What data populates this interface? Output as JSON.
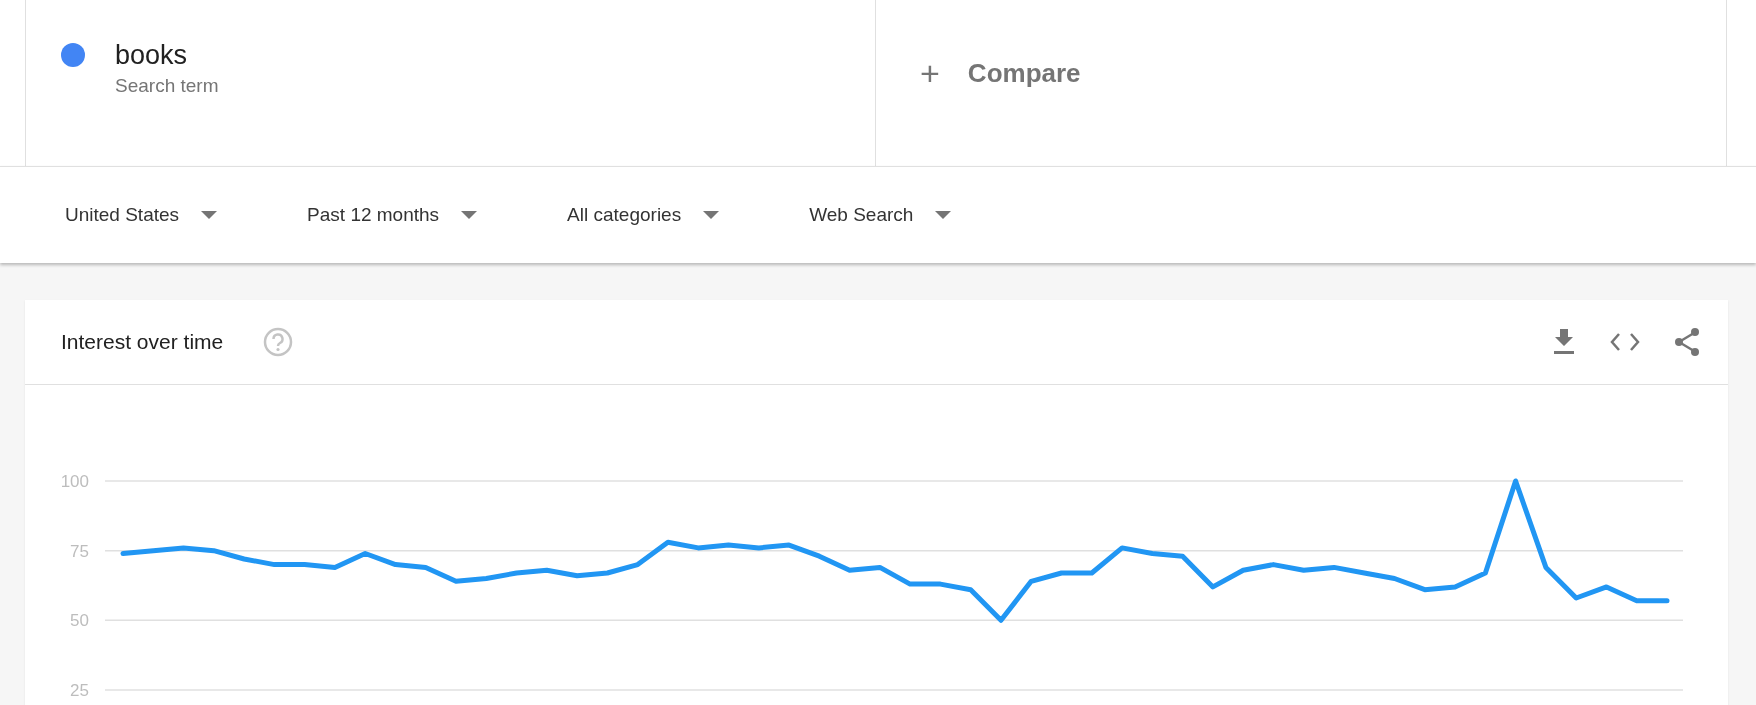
{
  "search_terms": [
    {
      "term": "books",
      "subtitle": "Search term",
      "color": "#4285f4"
    }
  ],
  "compare": {
    "icon": "+",
    "label": "Compare"
  },
  "filters": [
    {
      "label": "United States"
    },
    {
      "label": "Past 12 months"
    },
    {
      "label": "All categories"
    },
    {
      "label": "Web Search"
    }
  ],
  "card": {
    "title": "Interest over time",
    "chart_data": {
      "type": "line",
      "ylim": [
        25,
        100
      ],
      "yticks": [
        25,
        50,
        75,
        100
      ],
      "series": [
        {
          "color": "#2196f3",
          "values": [
            74,
            75,
            76,
            75,
            72,
            70,
            70,
            69,
            74,
            70,
            69,
            64,
            65,
            67,
            68,
            66,
            67,
            70,
            78,
            76,
            77,
            76,
            77,
            73,
            68,
            69,
            63,
            63,
            61,
            50,
            64,
            67,
            67,
            76,
            74,
            73,
            62,
            68,
            70,
            68,
            69,
            67,
            65,
            61,
            62,
            67,
            100,
            69,
            58,
            62,
            57,
            57
          ]
        }
      ]
    }
  }
}
